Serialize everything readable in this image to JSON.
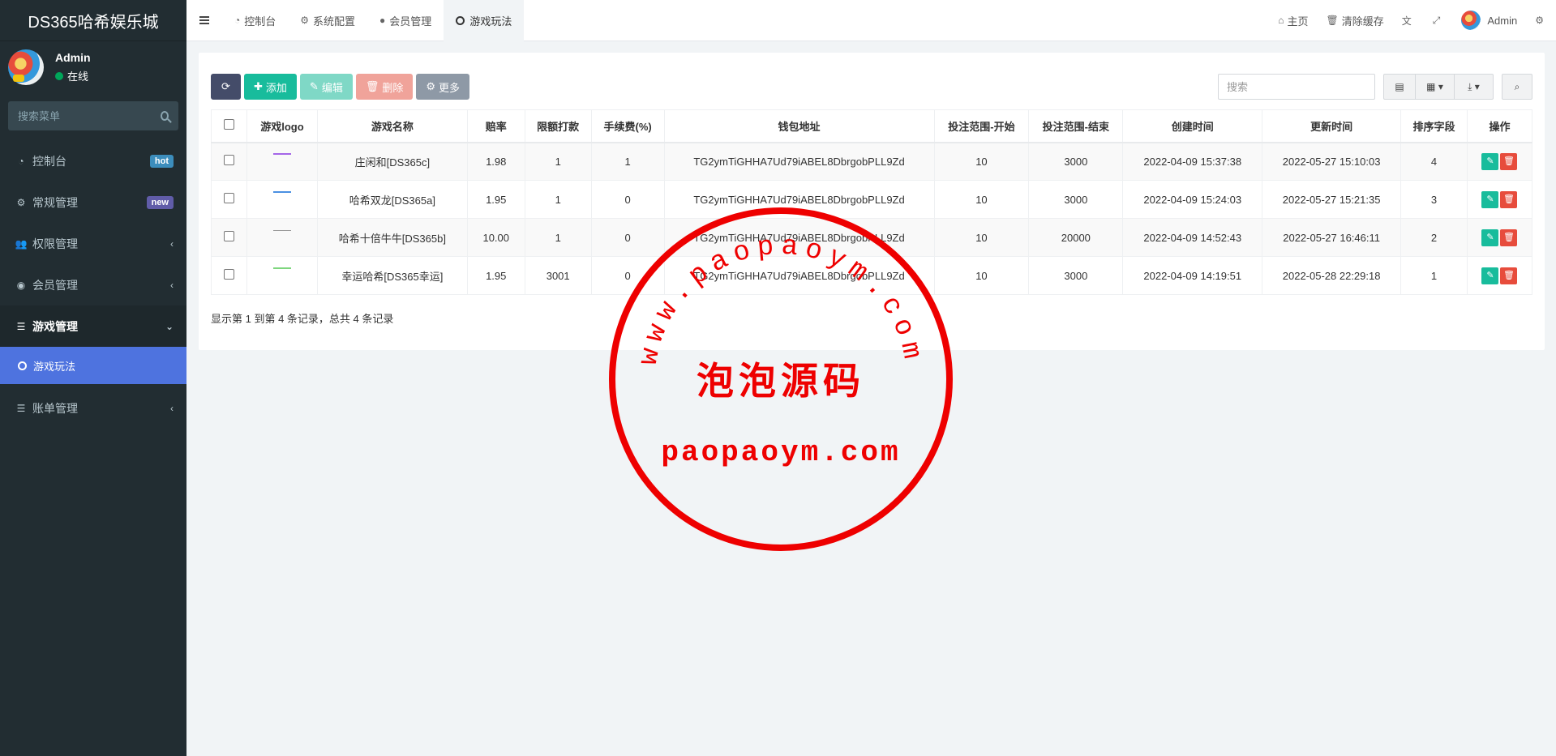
{
  "brand": {
    "title": "DS365哈希娱乐城"
  },
  "user": {
    "name": "Admin",
    "status": "在线"
  },
  "sidebar": {
    "search_placeholder": "搜索菜单",
    "items": [
      {
        "label": "控制台",
        "icon": "dashboard-icon",
        "badge": "hot"
      },
      {
        "label": "常规管理",
        "icon": "cogs-icon",
        "badge": "new"
      },
      {
        "label": "权限管理",
        "icon": "users-icon",
        "chevron": "‹"
      },
      {
        "label": "会员管理",
        "icon": "user-circle-icon",
        "chevron": "‹"
      },
      {
        "label": "游戏管理",
        "icon": "list-icon",
        "chevron": "⌄"
      },
      {
        "label": "账单管理",
        "icon": "list-icon",
        "chevron": "‹"
      }
    ],
    "sub_active": "游戏玩法"
  },
  "topnav": {
    "tabs": [
      {
        "label": "控制台",
        "icon": "dashboard-icon"
      },
      {
        "label": "系统配置",
        "icon": "cog-icon"
      },
      {
        "label": "会员管理",
        "icon": "user-icon"
      },
      {
        "label": "游戏玩法",
        "icon": "circle-icon"
      }
    ],
    "home": "主页",
    "clear_cache": "清除缓存",
    "admin": "Admin"
  },
  "toolbar": {
    "add": "添加",
    "edit": "编辑",
    "delete": "删除",
    "more": "更多",
    "search_placeholder": "搜索"
  },
  "table": {
    "headers": [
      "游戏logo",
      "游戏名称",
      "赔率",
      "限额打款",
      "手续费(%)",
      "钱包地址",
      "投注范围-开始",
      "投注范围-结束",
      "创建时间",
      "更新时间",
      "排序字段",
      "操作"
    ],
    "rows": [
      {
        "logo_color": "#a566e8",
        "name": "庄闲和[DS365c]",
        "odds": "1.98",
        "limit": "1",
        "fee": "1",
        "wallet": "TG2ymTiGHHA7Ud79iABEL8DbrgobPLL9Zd",
        "bet_start": "10",
        "bet_end": "3000",
        "created": "2022-04-09 15:37:38",
        "updated": "2022-05-27 15:10:03",
        "sort": "4"
      },
      {
        "logo_color": "#4a90e2",
        "name": "哈希双龙[DS365a]",
        "odds": "1.95",
        "limit": "1",
        "fee": "0",
        "wallet": "TG2ymTiGHHA7Ud79iABEL8DbrgobPLL9Zd",
        "bet_start": "10",
        "bet_end": "3000",
        "created": "2022-04-09 15:24:03",
        "updated": "2022-05-27 15:21:35",
        "sort": "3"
      },
      {
        "logo_color": "#999999",
        "name": "哈希十倍牛牛[DS365b]",
        "odds": "10.00",
        "limit": "1",
        "fee": "0",
        "wallet": "TG2ymTiGHHA7Ud79iABEL8DbrgobPLL9Zd",
        "bet_start": "10",
        "bet_end": "20000",
        "created": "2022-04-09 14:52:43",
        "updated": "2022-05-27 16:46:11",
        "sort": "2"
      },
      {
        "logo_color": "#7ed67e",
        "name": "幸运哈希[DS365幸运]",
        "odds": "1.95",
        "limit": "3001",
        "fee": "0",
        "wallet": "TG2ymTiGHHA7Ud79iABEL8DbrgobPLL9Zd",
        "bet_start": "10",
        "bet_end": "3000",
        "created": "2022-04-09 14:19:51",
        "updated": "2022-05-28 22:29:18",
        "sort": "1"
      }
    ]
  },
  "pager": {
    "text": "显示第 1 到第 4 条记录，总共 4 条记录"
  },
  "watermark": {
    "arc": "www.paopaoym.com",
    "center": "泡泡源码",
    "domain": "paopaoym.com",
    "color": "#ee0000"
  }
}
